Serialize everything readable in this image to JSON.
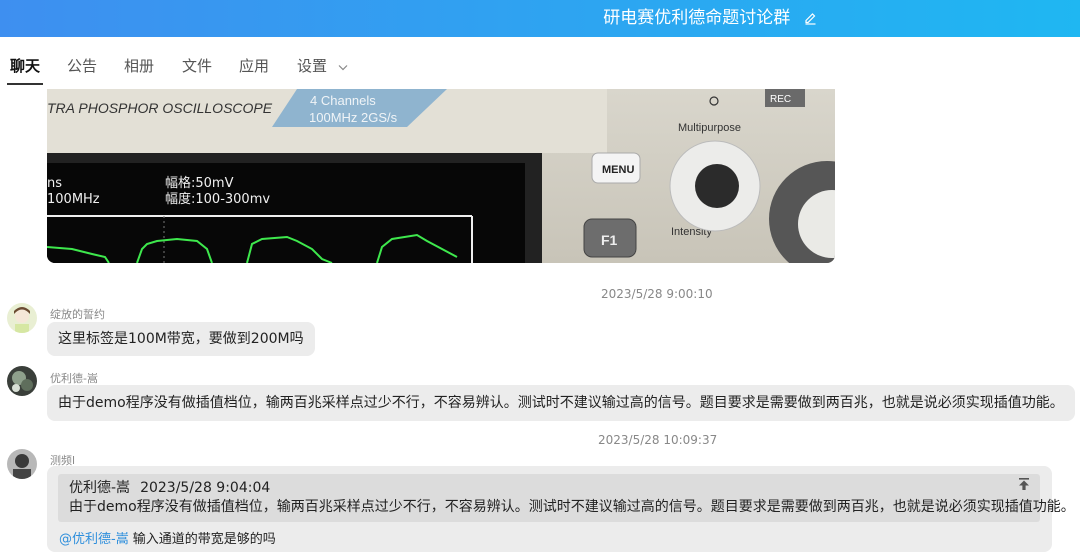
{
  "header": {
    "title": "研电赛优利德命题讨论群"
  },
  "tabs": [
    {
      "label": "聊天"
    },
    {
      "label": "公告"
    },
    {
      "label": "相册"
    },
    {
      "label": "文件"
    },
    {
      "label": "应用"
    },
    {
      "label": "设置"
    }
  ],
  "photo": {
    "brand": "TRA PHOSPHOR OSCILLOSCOPE",
    "channels": "4 Channels",
    "spec": "100MHz  2GS/s",
    "screen_line1a": "ns",
    "screen_line1b": "幅格:50mV",
    "screen_line2a": "100MHz",
    "screen_line2b": "幅度:100-300mv",
    "menu": "MENU",
    "f1": "F1",
    "multipurpose": "Multipurpose",
    "intensity": "Intensity",
    "rec": "REC"
  },
  "messages": [
    {
      "timestamp": "2023/5/28 9:00:10",
      "nick": "绽放的誓约",
      "text": "这里标签是100M带宽，要做到200M吗"
    },
    {
      "nick": "优利德-嵩",
      "text": "由于demo程序没有做插值档位，输两百兆采样点过少不行，不容易辨认。测试时不建议输过高的信号。题目要求是需要做到两百兆，也就是说必须实现插值功能。"
    },
    {
      "timestamp": "2023/5/28 10:09:37",
      "nick": "测频l",
      "quote": {
        "author": "优利德-嵩",
        "time": "2023/5/28 9:04:04",
        "text": "由于demo程序没有做插值档位，输两百兆采样点过少不行，不容易辨认。测试时不建议输过高的信号。题目要求是需要做到两百兆，也就是说必须实现插值功能。"
      },
      "mention": "@优利德-嵩",
      "reply": "输入通道的带宽是够的吗"
    }
  ],
  "colors": {
    "header_start": "#3e8ff0",
    "header_end": "#1fb7f2",
    "mention": "#2f8fdc",
    "bubble": "#ececec"
  }
}
